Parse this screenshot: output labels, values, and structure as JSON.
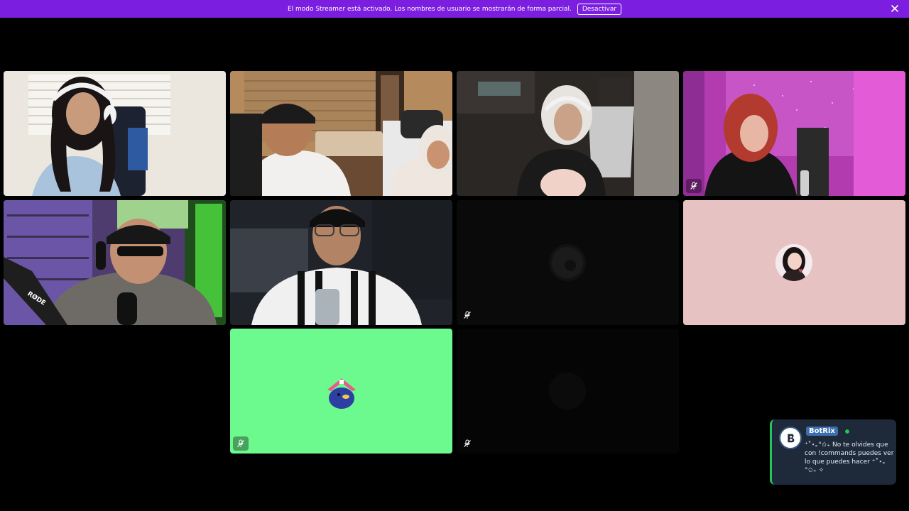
{
  "banner": {
    "message": "El modo Streamer está activado. Los nombres de usuario se mostrarán de forma parcial.",
    "button_label": "Desactivar",
    "bg_color": "#7b1ee0"
  },
  "tiles": [
    {
      "id": "participant-1",
      "camera_on": true,
      "muted": false,
      "speaking": false
    },
    {
      "id": "participant-2",
      "camera_on": true,
      "muted": false,
      "speaking": false
    },
    {
      "id": "participant-3",
      "camera_on": true,
      "muted": false,
      "speaking": false
    },
    {
      "id": "participant-4",
      "camera_on": true,
      "muted": true,
      "speaking": false
    },
    {
      "id": "participant-5",
      "camera_on": true,
      "muted": false,
      "speaking": true,
      "mic_brand": "RØDE"
    },
    {
      "id": "participant-6",
      "camera_on": true,
      "muted": false,
      "speaking": false
    },
    {
      "id": "participant-7",
      "camera_on": false,
      "muted": true,
      "speaking": false
    },
    {
      "id": "participant-8",
      "camera_on": false,
      "muted": false,
      "speaking": false,
      "bg_color": "#e6c2c2"
    },
    {
      "id": "participant-9",
      "camera_on": false,
      "muted": true,
      "speaking": false,
      "bg_color": "#6cf98e"
    },
    {
      "id": "participant-10",
      "camera_on": false,
      "muted": true,
      "speaking": false
    }
  ],
  "notification": {
    "bot_name": "BotRix",
    "message": "⁺˚⋆｡°✩₊ No te olvides que con !commands puedes ver lo que puedes hacer ⁺˚⋆｡°✩₊ ✧",
    "online": true,
    "accent_color": "#22c55e"
  },
  "icons": {
    "mute": "muted-mic-icon",
    "close": "close-icon",
    "bot": "bot-logo-icon"
  }
}
